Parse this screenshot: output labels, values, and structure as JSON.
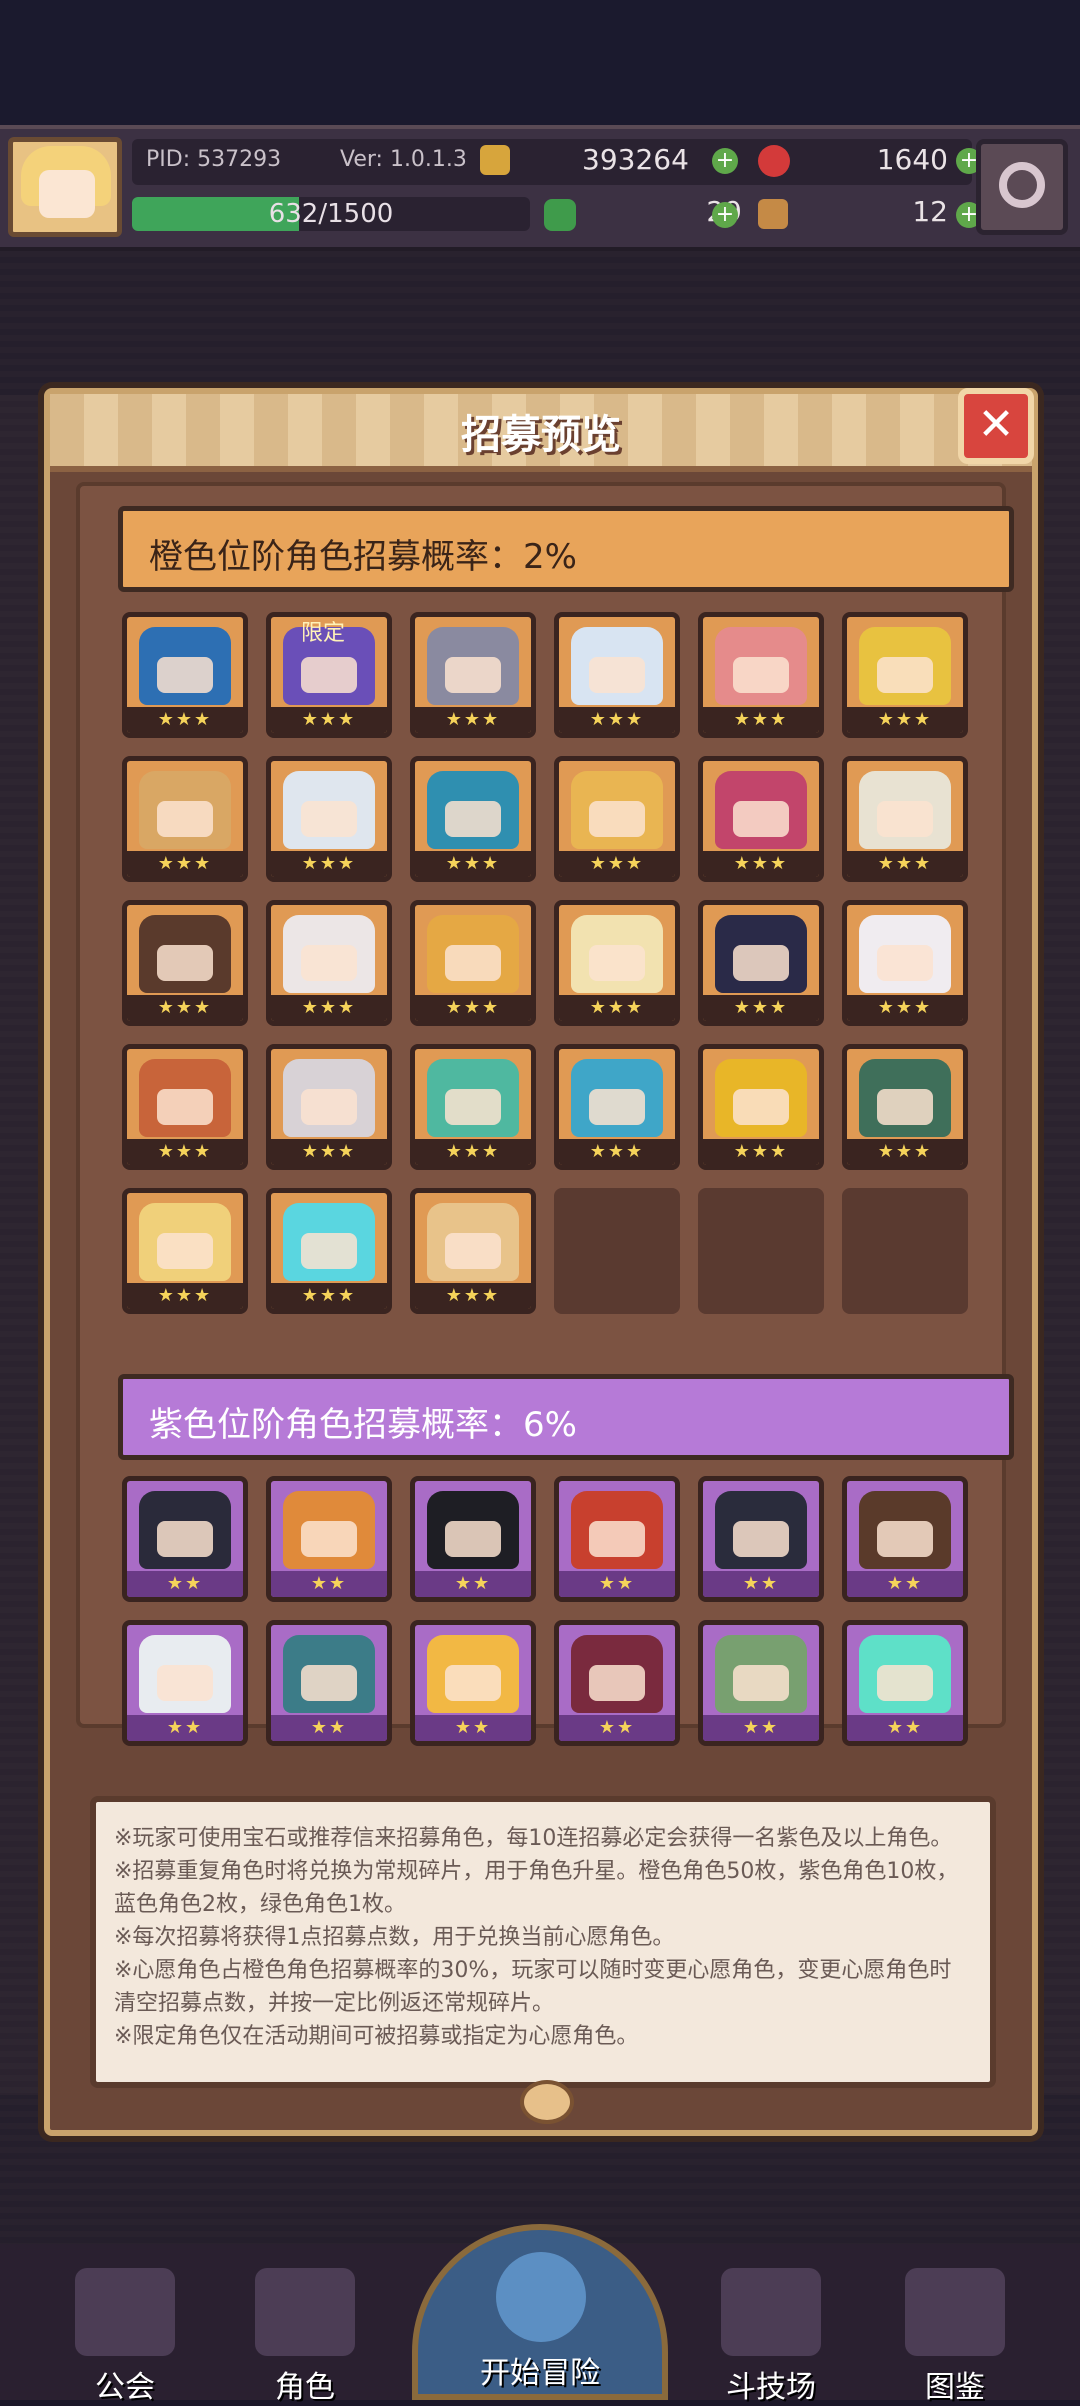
{
  "status_bar": {
    "pid": "PID: 537293",
    "version": "Ver: 1.0.1.3",
    "coins": "393264",
    "gems": "1640",
    "exp_text": "632/1500",
    "exp_fraction": 0.42,
    "clovers": "29",
    "tickets": "12",
    "plus_symbol": "+"
  },
  "modal": {
    "title": "招募预览",
    "close_label": "✕",
    "orange_rate_label": "橙色位阶角色招募概率：2%",
    "purple_rate_label": "紫色位阶角色招募概率：6%",
    "limited_tag": "限定",
    "stars_orange": "★★★",
    "stars_purple": "★★",
    "notes": [
      "※玩家可使用宝石或推荐信来招募角色，每10连招募必定会获得一名紫色及以上角色。",
      "※招募重复角色时将兑换为常规碎片，用于角色升星。橙色角色50枚，紫色角色10枚，蓝色角色2枚，绿色角色1枚。",
      "※每次招募将获得1点招募点数，用于兑换当前心愿角色。",
      "※心愿角色占橙色角色招募概率的30%，玩家可以随时变更心愿角色，变更心愿角色时清空招募点数，并按一定比例返还常规碎片。",
      "※限定角色仅在活动期间可被招募或指定为心愿角色。"
    ]
  },
  "orange_characters": [
    {
      "hair": "#2d6fb3",
      "limited": false
    },
    {
      "hair": "#6a4fb8",
      "limited": true
    },
    {
      "hair": "#8a8aa0",
      "limited": false
    },
    {
      "hair": "#d8e4f2",
      "limited": false
    },
    {
      "hair": "#e58b8b",
      "limited": false
    },
    {
      "hair": "#e8c240",
      "limited": false
    },
    {
      "hair": "#d9a764",
      "limited": false
    },
    {
      "hair": "#dfe6ee",
      "limited": false
    },
    {
      "hair": "#2f8fb0",
      "limited": false
    },
    {
      "hair": "#e9b552",
      "limited": false
    },
    {
      "hair": "#c2456b",
      "limited": false
    },
    {
      "hair": "#e8e2d2",
      "limited": false
    },
    {
      "hair": "#5a3a2c",
      "limited": false
    },
    {
      "hair": "#ece6e6",
      "limited": false
    },
    {
      "hair": "#e5a844",
      "limited": false
    },
    {
      "hair": "#f2e2b0",
      "limited": false
    },
    {
      "hair": "#2a2a48",
      "limited": false
    },
    {
      "hair": "#f0ecf0",
      "limited": false
    },
    {
      "hair": "#c8643a",
      "limited": false
    },
    {
      "hair": "#d8d2d6",
      "limited": false
    },
    {
      "hair": "#4fb8a0",
      "limited": false
    },
    {
      "hair": "#3fa6c8",
      "limited": false
    },
    {
      "hair": "#e8b628",
      "limited": false
    },
    {
      "hair": "#3f6f5a",
      "limited": false
    },
    {
      "hair": "#f0d07a",
      "limited": false
    },
    {
      "hair": "#5ad6e0",
      "limited": false
    },
    {
      "hair": "#e8c38a",
      "limited": false
    }
  ],
  "purple_characters": [
    {
      "hair": "#2a2a3a"
    },
    {
      "hair": "#e08a3a"
    },
    {
      "hair": "#1e1e24"
    },
    {
      "hair": "#c8402e"
    },
    {
      "hair": "#2a2c3c"
    },
    {
      "hair": "#5a3a2a"
    },
    {
      "hair": "#e8ecf0"
    },
    {
      "hair": "#3c7c88"
    },
    {
      "hair": "#f2b844"
    },
    {
      "hair": "#7a2a3e"
    },
    {
      "hair": "#78a070"
    },
    {
      "hair": "#5ee0c8"
    }
  ],
  "bottom_nav": [
    {
      "label": "公会",
      "icon": "guild-icon"
    },
    {
      "label": "角色",
      "icon": "character-icon"
    },
    {
      "label": "开始冒险",
      "icon": "magnifier-icon"
    },
    {
      "label": "斗技场",
      "icon": "swords-icon"
    },
    {
      "label": "图鉴",
      "icon": "book-icon"
    }
  ]
}
